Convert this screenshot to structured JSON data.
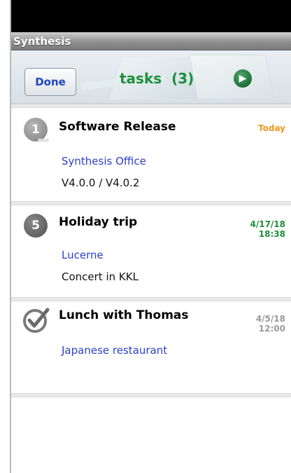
{
  "app": {
    "title": "Synthesis"
  },
  "toolbar": {
    "done_label": "Done",
    "title": "tasks  (3)"
  },
  "tasks": [
    {
      "badge": "1",
      "title": "Software Release",
      "date_line1": "Today",
      "date_line2": "",
      "date_color": "#f0961e",
      "location": "Synthesis Office",
      "note": "V4.0.0 / V4.0.2"
    },
    {
      "badge": "5",
      "title": "Holiday trip",
      "date_line1": "4/17/18",
      "date_line2": "18:38",
      "date_color": "#1e8e3a",
      "location": "Lucerne",
      "note": "Concert in KKL"
    },
    {
      "badge": "check",
      "title": "Lunch with Thomas",
      "date_line1": "4/5/18",
      "date_line2": "12:00",
      "date_color": "#9a9a9a",
      "location": "Japanese restaurant",
      "note": ""
    }
  ],
  "colors": {
    "accent_green": "#1e8e3a",
    "link_blue": "#2c41c9",
    "today_orange": "#f0961e"
  }
}
